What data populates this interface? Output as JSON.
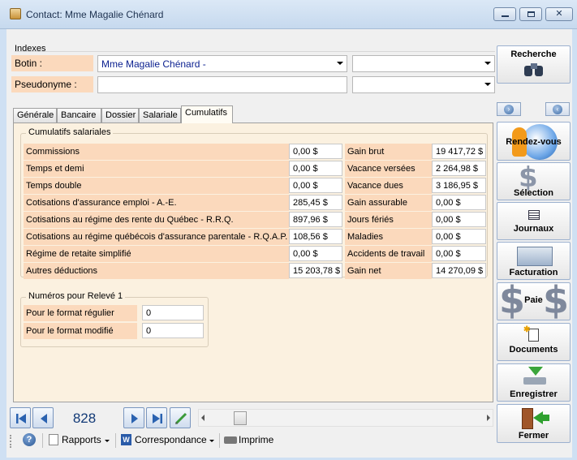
{
  "window": {
    "title": "Contact: Mme Magalie Chénard",
    "minimize": "▭",
    "restore": "▭",
    "close": "✕"
  },
  "indexes": {
    "group_label": "Indexes",
    "botin_label": "Botin :",
    "botin_value": "Mme Magalie Chénard  -",
    "botin_second_value": "",
    "pseudonyme_label": "Pseudonyme :",
    "pseudonyme_value": "",
    "pseudonyme_second_value": ""
  },
  "tabs": [
    {
      "label": "Générale",
      "active": false
    },
    {
      "label": "Bancaire",
      "active": false
    },
    {
      "label": "Dossier",
      "active": false
    },
    {
      "label": "Salariale",
      "active": false
    },
    {
      "label": "Cumulatifs",
      "active": true
    }
  ],
  "cumulatifs": {
    "group_label": "Cumulatifs salariales",
    "left_rows": [
      {
        "label": "Commissions",
        "value": "0,00 $"
      },
      {
        "label": "Temps et demi",
        "value": "0,00 $"
      },
      {
        "label": "Temps double",
        "value": "0,00 $"
      },
      {
        "label": "Cotisations d'assurance emploi - A.-E.",
        "value": "285,45 $"
      },
      {
        "label": "Cotisations au régime des rente du Québec - R.R.Q.",
        "value": "897,96 $"
      },
      {
        "label": "Cotisations au régime québécois d'assurance parentale  - R.Q.A.P.",
        "value": "108,56 $"
      },
      {
        "label": "Régime de retaite simplifié",
        "value": "0,00 $"
      },
      {
        "label": "Autres déductions",
        "value": "15 203,78 $"
      }
    ],
    "right_rows": [
      {
        "label": "Gain brut",
        "value": "19 417,72 $"
      },
      {
        "label": "Vacance versées",
        "value": "2 264,98 $"
      },
      {
        "label": "Vacance dues",
        "value": "3 186,95 $"
      },
      {
        "label": "Gain assurable",
        "value": "0,00 $"
      },
      {
        "label": "Jours fériés",
        "value": "0,00 $"
      },
      {
        "label": "Maladies",
        "value": "0,00 $"
      },
      {
        "label": "Accidents de travail",
        "value": "0,00 $"
      },
      {
        "label": "Gain net",
        "value": "14 270,09 $"
      }
    ]
  },
  "releve": {
    "group_label": "Numéros pour Relevé 1",
    "rows": [
      {
        "label": "Pour le format régulier",
        "value": "0"
      },
      {
        "label": "Pour le format modifié",
        "value": "0"
      }
    ]
  },
  "navigation": {
    "record_number": "828"
  },
  "statusbar": {
    "rapports": "Rapports",
    "correspondance": "Correspondance",
    "imprime": "Imprime"
  },
  "sidebar": {
    "recherche": "Recherche",
    "rendez_vous": "Rendez-vous",
    "selection": "Sélection",
    "journaux": "Journaux",
    "facturation": "Facturation",
    "paie": "Paie",
    "documents": "Documents",
    "enregistrer": "Enregistrer",
    "fermer": "Fermer"
  }
}
